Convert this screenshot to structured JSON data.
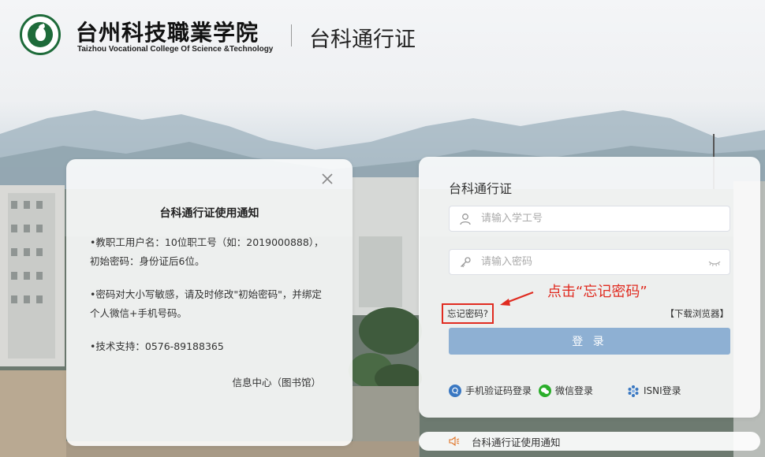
{
  "header": {
    "school_name_cn": "台州科技職業学院",
    "school_name_en": "Taizhou Vocational College Of Science &Technology",
    "system_title": "台科通行证"
  },
  "notice": {
    "title": "台科通行证使用通知",
    "paragraphs": [
      "•教职工用户名：10位职工号（如：2019000888），初始密码：身份证后6位。",
      "•密码对大小写敏感，请及时修改\"初始密码\"，并绑定个人微信+手机号码。",
      "•技术支持：0576-89188365"
    ],
    "signature": "信息中心（图书馆）"
  },
  "login": {
    "title": "台科通行证",
    "username_placeholder": "请输入学工号",
    "password_placeholder": "请输入密码",
    "forgot_password": "忘记密码?",
    "download_browser": "【下载浏览器】",
    "login_button": "登 录",
    "alt_logins": {
      "sms": "手机验证码登录",
      "wechat": "微信登录",
      "isni": "ISNI登录"
    }
  },
  "annotation": {
    "text": "点击“忘记密码”"
  },
  "notice_bar": {
    "label": "台科通行证使用通知"
  },
  "colors": {
    "brand_green": "#1e6b3a",
    "login_button": "#8eb0d3",
    "annotation_red": "#e02b20"
  }
}
